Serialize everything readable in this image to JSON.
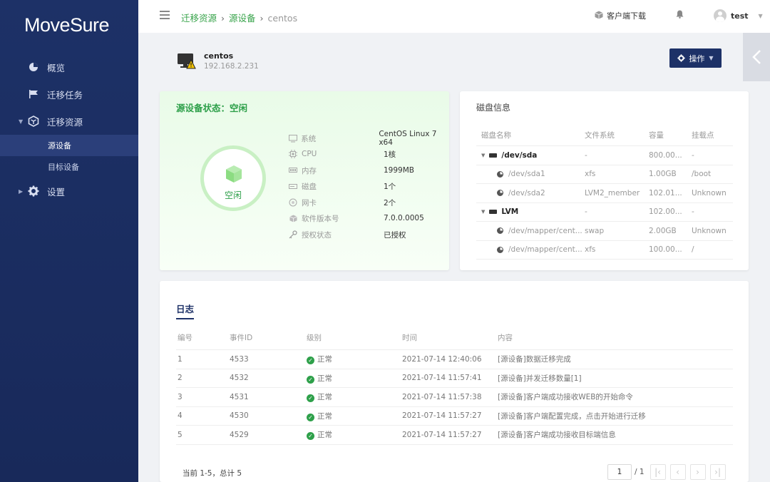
{
  "app": {
    "logo": "MoveSure"
  },
  "sidebar": {
    "items": [
      {
        "label": "概览",
        "icon": "pie-chart-icon"
      },
      {
        "label": "迁移任务",
        "icon": "flag-icon"
      },
      {
        "label": "迁移资源",
        "icon": "cube-icon"
      },
      {
        "label": "源设备"
      },
      {
        "label": "目标设备"
      },
      {
        "label": "设置",
        "icon": "gear-icon"
      }
    ]
  },
  "header": {
    "breadcrumb": [
      "迁移资源",
      "源设备",
      "centos"
    ],
    "download": "客户端下载",
    "user": "test"
  },
  "device": {
    "name": "centos",
    "ip": "192.168.2.231",
    "op_button": "操作"
  },
  "status": {
    "title": "源设备状态：空闲",
    "state": "空闲",
    "props": [
      {
        "key": "系统",
        "value": "CentOS Linux 7 x64",
        "icon": "monitor-icon"
      },
      {
        "key": "CPU",
        "value": "1核",
        "icon": "cpu-icon"
      },
      {
        "key": "内存",
        "value": "1999MB",
        "icon": "memory-icon"
      },
      {
        "key": "磁盘",
        "value": "1个",
        "icon": "disk-icon"
      },
      {
        "key": "网卡",
        "value": "2个",
        "icon": "nic-icon"
      },
      {
        "key": "软件版本号",
        "value": "7.0.0.0005",
        "icon": "package-icon"
      },
      {
        "key": "授权状态",
        "value": "已授权",
        "icon": "key-icon"
      }
    ]
  },
  "disk": {
    "title": "磁盘信息",
    "headers": [
      "磁盘名称",
      "文件系统",
      "容量",
      "挂载点"
    ],
    "rows": [
      {
        "name": "/dev/sda",
        "fs": "-",
        "size": "800.00...",
        "mount": "-",
        "group": true
      },
      {
        "name": "/dev/sda1",
        "fs": "xfs",
        "size": "1.00GB",
        "mount": "/boot",
        "group": false
      },
      {
        "name": "/dev/sda2",
        "fs": "LVM2_member",
        "size": "102.01...",
        "mount": "Unknown",
        "group": false
      },
      {
        "name": "LVM",
        "fs": "-",
        "size": "102.00...",
        "mount": "-",
        "group": true
      },
      {
        "name": "/dev/mapper/cent...",
        "fs": "swap",
        "size": "2.00GB",
        "mount": "Unknown",
        "group": false
      },
      {
        "name": "/dev/mapper/cent...",
        "fs": "xfs",
        "size": "100.00...",
        "mount": "/",
        "group": false
      }
    ]
  },
  "log": {
    "tab": "日志",
    "headers": [
      "编号",
      "事件ID",
      "级别",
      "时间",
      "内容"
    ],
    "rows": [
      {
        "no": "1",
        "id": "4533",
        "level": "正常",
        "time": "2021-07-14 12:40:06",
        "content": "[源设备]数据迁移完成"
      },
      {
        "no": "2",
        "id": "4532",
        "level": "正常",
        "time": "2021-07-14 11:57:41",
        "content": "[源设备]并发迁移数量[1]"
      },
      {
        "no": "3",
        "id": "4531",
        "level": "正常",
        "time": "2021-07-14 11:57:38",
        "content": "[源设备]客户端成功接收WEB的开始命令"
      },
      {
        "no": "4",
        "id": "4530",
        "level": "正常",
        "time": "2021-07-14 11:57:27",
        "content": "[源设备]客户端配置完成，点击开始进行迁移"
      },
      {
        "no": "5",
        "id": "4529",
        "level": "正常",
        "time": "2021-07-14 11:57:27",
        "content": "[源设备]客户端成功接收目标端信息"
      }
    ],
    "pagination": {
      "info": "当前 1-5，总计 5",
      "page": "1",
      "total": "/ 1"
    }
  }
}
